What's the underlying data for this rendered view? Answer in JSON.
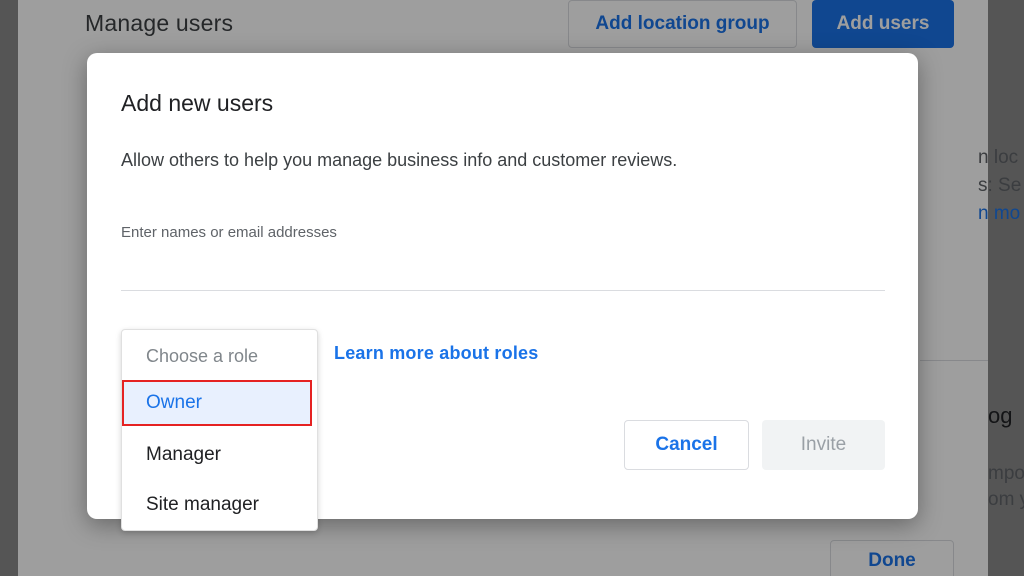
{
  "background": {
    "title": "Manage users",
    "add_location_group_label": "Add location group",
    "add_users_label": "Add users",
    "done_label": "Done",
    "fragments": [
      "n loc",
      "s: Se",
      "n mo",
      "og",
      "mpo",
      "om y"
    ]
  },
  "dialog": {
    "title": "Add new users",
    "description": "Allow others to help you manage business info and customer reviews.",
    "email_placeholder": "Enter names or email addresses",
    "email_value": "",
    "learn_more_label": "Learn more about roles",
    "cancel_label": "Cancel",
    "invite_label": "Invite"
  },
  "role_menu": {
    "placeholder": "Choose a role",
    "options": [
      "Owner",
      "Manager",
      "Site manager"
    ],
    "selected": "Owner"
  },
  "colors": {
    "accent": "#1a73e8",
    "highlight_border": "#e52222",
    "selected_bg": "#e8f0fe"
  }
}
